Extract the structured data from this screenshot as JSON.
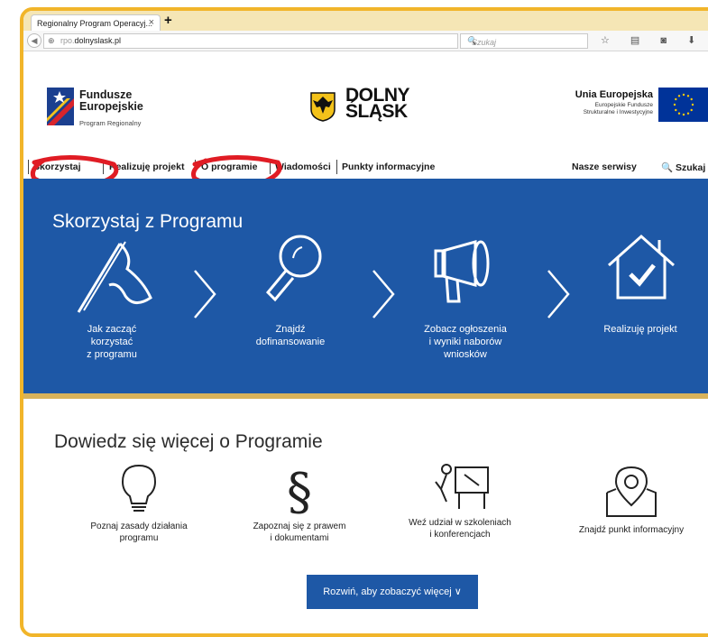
{
  "browser": {
    "tab_title": "Regionalny Program Operacyj...",
    "tab_close": "×",
    "new_tab": "+",
    "url_prefix": "rpo.",
    "url_domain": "dolnyslask.pl",
    "search_placeholder": "Szukaj",
    "reload_icon": "C",
    "toolbar_icons": "☆ ▤ ◙ ⬇ ⌂"
  },
  "header": {
    "left_logo_line1": "Fundusze",
    "left_logo_line2": "Europejskie",
    "left_logo_sub": "Program Regionalny",
    "center_logo_line1": "DOLNY",
    "center_logo_line2": "ŚLĄSK",
    "eu_title": "Unia Europejska",
    "eu_sub_line1": "Europejskie Fundusze",
    "eu_sub_line2": "Strukturalne i Inwestycyjne"
  },
  "nav": {
    "items": [
      {
        "label": "Skorzystaj"
      },
      {
        "label": "Realizuję projekt"
      },
      {
        "label": "O programie"
      },
      {
        "label": "Wiadomości"
      },
      {
        "label": "Punkty informacyjne"
      }
    ],
    "services": "Nasze serwisy",
    "search": "Szukaj"
  },
  "hero": {
    "title": "Skorzystaj z Programu",
    "steps": [
      {
        "lines": [
          "Jak zacząć",
          "korzystać",
          "z programu"
        ],
        "icon": "flag-icon"
      },
      {
        "lines": [
          "Znajdź",
          "dofinansowanie"
        ],
        "icon": "magnifier-icon"
      },
      {
        "lines": [
          "Zobacz ogłoszenia",
          "i wyniki naborów",
          "wniosków"
        ],
        "icon": "megaphone-icon"
      },
      {
        "lines": [
          "Realizuję projekt"
        ],
        "icon": "house-check-icon"
      }
    ]
  },
  "learn": {
    "title": "Dowiedz się więcej o Programie",
    "items": [
      {
        "lines": [
          "Poznaj zasady działania",
          "programu"
        ],
        "icon": "lightbulb-icon"
      },
      {
        "lines": [
          "Zapoznaj się z prawem",
          "i dokumentami"
        ],
        "icon": "paragraph-icon"
      },
      {
        "lines": [
          "Weź udział w szkoleniach",
          "i konferencjach"
        ],
        "icon": "presentation-icon"
      },
      {
        "lines": [
          "Znajdź punkt informacyjny"
        ],
        "icon": "map-pin-icon"
      }
    ],
    "expand_button": "Rozwiń, aby zobaczyć więcej ∨"
  },
  "colors": {
    "frame": "#f1b52a",
    "hero_blue": "#1e58a6",
    "hero_border": "#d8b25a",
    "red_annotation": "#e01c24"
  }
}
